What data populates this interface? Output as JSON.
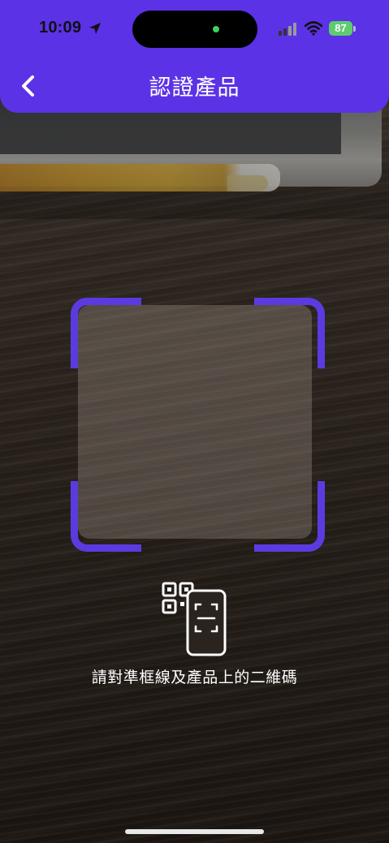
{
  "status_bar": {
    "time": "10:09",
    "battery": "87",
    "icons": [
      "location-arrow-icon",
      "signal-icon",
      "wifi-icon",
      "battery-icon"
    ]
  },
  "header": {
    "title": "認證產品",
    "back_icon": "chevron-left-icon",
    "color": "#5b32e6"
  },
  "scanner": {
    "frame_color": "#5b3be0",
    "illustration_icon": "qr-phone-scan-icon",
    "instruction": "請對準框線及產品上的二維碼"
  }
}
